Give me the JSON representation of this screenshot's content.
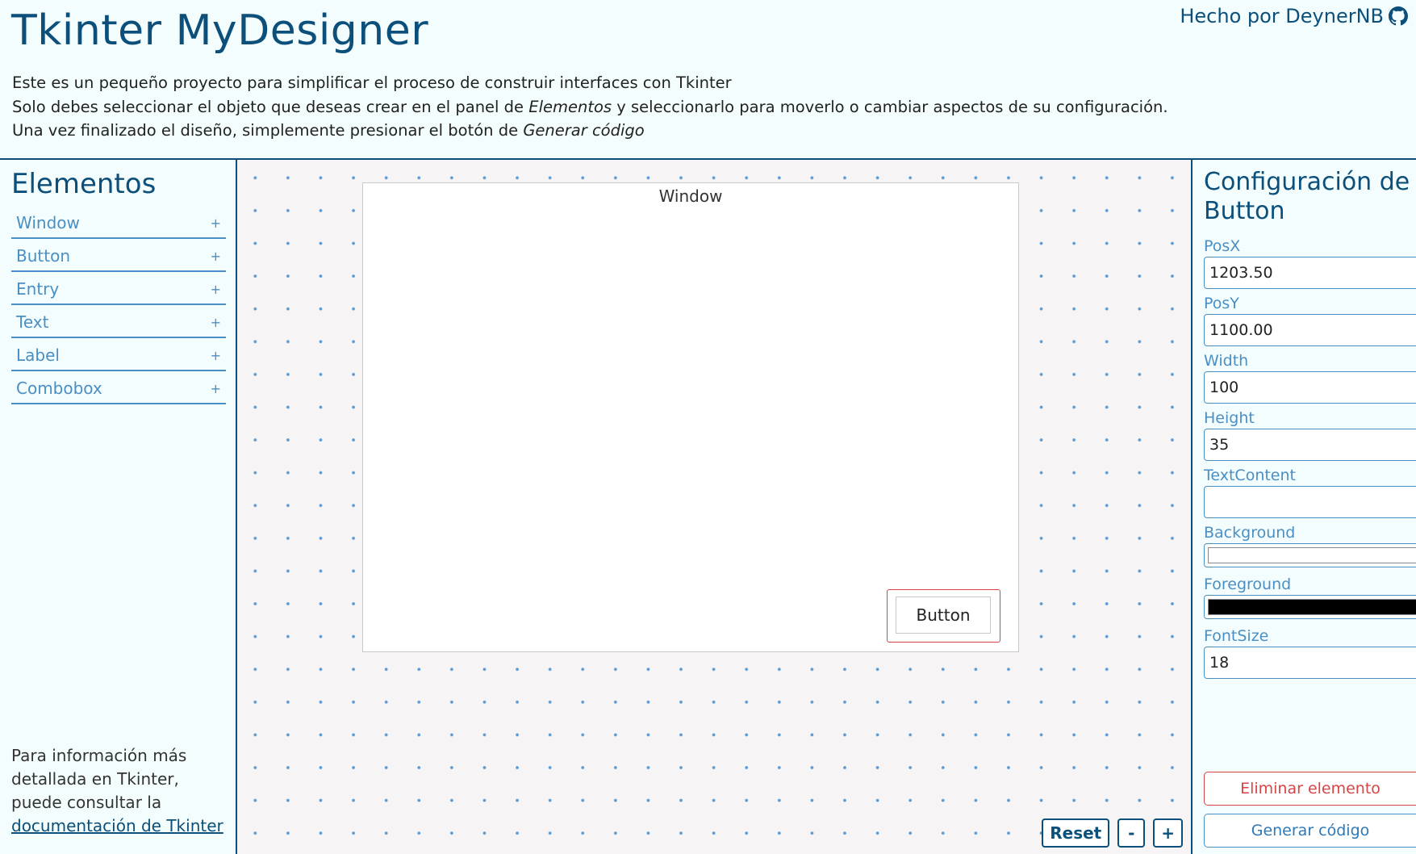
{
  "header": {
    "title": "Tkinter MyDesigner",
    "author": "Hecho por DeynerNB",
    "description": {
      "line1": "Este es un pequeño proyecto para simplificar el proceso de construir interfaces con Tkinter",
      "line2_a": "Solo debes seleccionar el objeto que deseas crear en el panel de ",
      "line2_em": "Elementos",
      "line2_b": " y seleccionarlo para moverlo o cambiar aspectos de su configuración.",
      "line3_a": "Una vez finalizado el diseño, simplemente presionar el botón de ",
      "line3_em": "Generar código"
    }
  },
  "elements_panel": {
    "title": "Elementos",
    "add_symbol": "+",
    "items": [
      {
        "label": "Window"
      },
      {
        "label": "Button"
      },
      {
        "label": "Entry"
      },
      {
        "label": "Text"
      },
      {
        "label": "Label"
      },
      {
        "label": "Combobox"
      }
    ],
    "info_text": "Para información más detallada en Tkinter, puede consultar la",
    "info_link": "documentación de Tkinter"
  },
  "canvas": {
    "window_label": "Window",
    "button_text": "Button",
    "controls": {
      "reset": "Reset",
      "zoom_out": "-",
      "zoom_in": "+"
    }
  },
  "config_panel": {
    "title": "Configuración de Button",
    "fields": {
      "posx": {
        "label": "PosX",
        "value": "1203.50"
      },
      "posy": {
        "label": "PosY",
        "value": "1100.00"
      },
      "width": {
        "label": "Width",
        "value": "100"
      },
      "height": {
        "label": "Height",
        "value": "35"
      },
      "text_content": {
        "label": "TextContent",
        "value": ""
      },
      "background": {
        "label": "Background",
        "color": "#ffffff"
      },
      "foreground": {
        "label": "Foreground",
        "color": "#000000"
      },
      "font_size": {
        "label": "FontSize",
        "value": "18"
      }
    },
    "delete_button": "Eliminar elemento",
    "generate_button": "Generar código"
  },
  "colors": {
    "brand": "#0b4f7a",
    "accent": "#4a8fc4",
    "danger": "#d64545",
    "background": "#f4fdfd"
  }
}
